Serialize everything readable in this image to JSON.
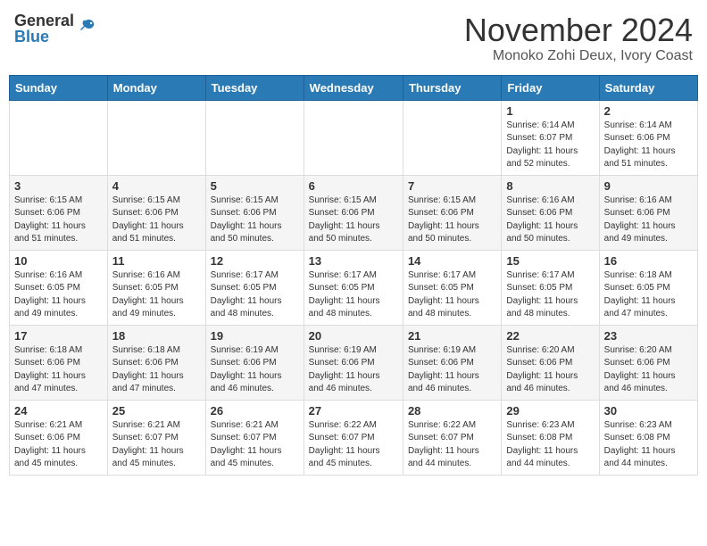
{
  "header": {
    "logo_general": "General",
    "logo_blue": "Blue",
    "month_title": "November 2024",
    "location": "Monoko Zohi Deux, Ivory Coast"
  },
  "weekdays": [
    "Sunday",
    "Monday",
    "Tuesday",
    "Wednesday",
    "Thursday",
    "Friday",
    "Saturday"
  ],
  "weeks": [
    [
      {
        "day": "",
        "info": ""
      },
      {
        "day": "",
        "info": ""
      },
      {
        "day": "",
        "info": ""
      },
      {
        "day": "",
        "info": ""
      },
      {
        "day": "",
        "info": ""
      },
      {
        "day": "1",
        "info": "Sunrise: 6:14 AM\nSunset: 6:07 PM\nDaylight: 11 hours\nand 52 minutes."
      },
      {
        "day": "2",
        "info": "Sunrise: 6:14 AM\nSunset: 6:06 PM\nDaylight: 11 hours\nand 51 minutes."
      }
    ],
    [
      {
        "day": "3",
        "info": "Sunrise: 6:15 AM\nSunset: 6:06 PM\nDaylight: 11 hours\nand 51 minutes."
      },
      {
        "day": "4",
        "info": "Sunrise: 6:15 AM\nSunset: 6:06 PM\nDaylight: 11 hours\nand 51 minutes."
      },
      {
        "day": "5",
        "info": "Sunrise: 6:15 AM\nSunset: 6:06 PM\nDaylight: 11 hours\nand 50 minutes."
      },
      {
        "day": "6",
        "info": "Sunrise: 6:15 AM\nSunset: 6:06 PM\nDaylight: 11 hours\nand 50 minutes."
      },
      {
        "day": "7",
        "info": "Sunrise: 6:15 AM\nSunset: 6:06 PM\nDaylight: 11 hours\nand 50 minutes."
      },
      {
        "day": "8",
        "info": "Sunrise: 6:16 AM\nSunset: 6:06 PM\nDaylight: 11 hours\nand 50 minutes."
      },
      {
        "day": "9",
        "info": "Sunrise: 6:16 AM\nSunset: 6:06 PM\nDaylight: 11 hours\nand 49 minutes."
      }
    ],
    [
      {
        "day": "10",
        "info": "Sunrise: 6:16 AM\nSunset: 6:05 PM\nDaylight: 11 hours\nand 49 minutes."
      },
      {
        "day": "11",
        "info": "Sunrise: 6:16 AM\nSunset: 6:05 PM\nDaylight: 11 hours\nand 49 minutes."
      },
      {
        "day": "12",
        "info": "Sunrise: 6:17 AM\nSunset: 6:05 PM\nDaylight: 11 hours\nand 48 minutes."
      },
      {
        "day": "13",
        "info": "Sunrise: 6:17 AM\nSunset: 6:05 PM\nDaylight: 11 hours\nand 48 minutes."
      },
      {
        "day": "14",
        "info": "Sunrise: 6:17 AM\nSunset: 6:05 PM\nDaylight: 11 hours\nand 48 minutes."
      },
      {
        "day": "15",
        "info": "Sunrise: 6:17 AM\nSunset: 6:05 PM\nDaylight: 11 hours\nand 48 minutes."
      },
      {
        "day": "16",
        "info": "Sunrise: 6:18 AM\nSunset: 6:05 PM\nDaylight: 11 hours\nand 47 minutes."
      }
    ],
    [
      {
        "day": "17",
        "info": "Sunrise: 6:18 AM\nSunset: 6:06 PM\nDaylight: 11 hours\nand 47 minutes."
      },
      {
        "day": "18",
        "info": "Sunrise: 6:18 AM\nSunset: 6:06 PM\nDaylight: 11 hours\nand 47 minutes."
      },
      {
        "day": "19",
        "info": "Sunrise: 6:19 AM\nSunset: 6:06 PM\nDaylight: 11 hours\nand 46 minutes."
      },
      {
        "day": "20",
        "info": "Sunrise: 6:19 AM\nSunset: 6:06 PM\nDaylight: 11 hours\nand 46 minutes."
      },
      {
        "day": "21",
        "info": "Sunrise: 6:19 AM\nSunset: 6:06 PM\nDaylight: 11 hours\nand 46 minutes."
      },
      {
        "day": "22",
        "info": "Sunrise: 6:20 AM\nSunset: 6:06 PM\nDaylight: 11 hours\nand 46 minutes."
      },
      {
        "day": "23",
        "info": "Sunrise: 6:20 AM\nSunset: 6:06 PM\nDaylight: 11 hours\nand 46 minutes."
      }
    ],
    [
      {
        "day": "24",
        "info": "Sunrise: 6:21 AM\nSunset: 6:06 PM\nDaylight: 11 hours\nand 45 minutes."
      },
      {
        "day": "25",
        "info": "Sunrise: 6:21 AM\nSunset: 6:07 PM\nDaylight: 11 hours\nand 45 minutes."
      },
      {
        "day": "26",
        "info": "Sunrise: 6:21 AM\nSunset: 6:07 PM\nDaylight: 11 hours\nand 45 minutes."
      },
      {
        "day": "27",
        "info": "Sunrise: 6:22 AM\nSunset: 6:07 PM\nDaylight: 11 hours\nand 45 minutes."
      },
      {
        "day": "28",
        "info": "Sunrise: 6:22 AM\nSunset: 6:07 PM\nDaylight: 11 hours\nand 44 minutes."
      },
      {
        "day": "29",
        "info": "Sunrise: 6:23 AM\nSunset: 6:08 PM\nDaylight: 11 hours\nand 44 minutes."
      },
      {
        "day": "30",
        "info": "Sunrise: 6:23 AM\nSunset: 6:08 PM\nDaylight: 11 hours\nand 44 minutes."
      }
    ]
  ]
}
